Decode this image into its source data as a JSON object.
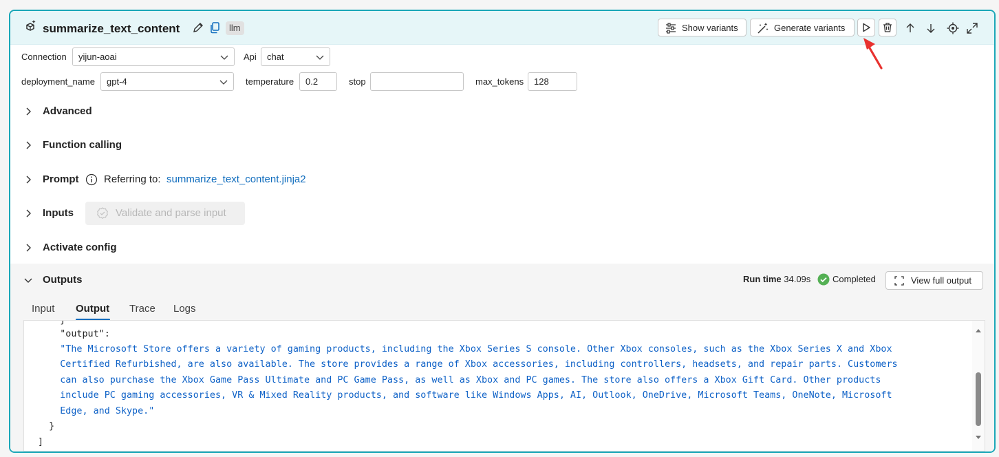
{
  "node": {
    "title": "summarize_text_content",
    "badge": "llm",
    "buttons": {
      "show_variants": "Show variants",
      "generate_variants": "Generate variants"
    }
  },
  "config": {
    "connection_label": "Connection",
    "connection_value": "yijun-aoai",
    "api_label": "Api",
    "api_value": "chat",
    "deployment_label": "deployment_name",
    "deployment_value": "gpt-4",
    "temperature_label": "temperature",
    "temperature_value": "0.2",
    "stop_label": "stop",
    "stop_value": "",
    "max_tokens_label": "max_tokens",
    "max_tokens_value": "128"
  },
  "sections": {
    "advanced": "Advanced",
    "function_calling": "Function calling",
    "prompt": "Prompt",
    "prompt_ref_label": "Referring to:",
    "prompt_ref_link": "summarize_text_content.jinja2",
    "inputs": "Inputs",
    "validate_button": "Validate and parse input",
    "activate_config": "Activate config",
    "outputs": "Outputs"
  },
  "outputs": {
    "run_time_label": "Run time",
    "run_time_value": "34.09s",
    "status": "Completed",
    "view_full_output": "View full output",
    "tabs": [
      "Input",
      "Output",
      "Trace",
      "Logs"
    ],
    "active_tab": "Output",
    "code_lines": [
      "    }",
      "    \"output\":",
      "    \"The Microsoft Store offers a variety of gaming products, including the Xbox Series S console. Other Xbox consoles, such as the Xbox Series X and Xbox",
      "    Certified Refurbished, are also available. The store provides a range of Xbox accessories, including controllers, headsets, and repair parts. Customers",
      "    can also purchase the Xbox Game Pass Ultimate and PC Game Pass, as well as Xbox and PC games. The store also offers a Xbox Gift Card. Other products",
      "    include PC gaming accessories, VR & Mixed Reality products, and software like Windows Apps, AI, Outlook, OneDrive, Microsoft Teams, OneNote, Microsoft",
      "    Edge, and Skype.\"",
      "  }",
      "]"
    ]
  },
  "colors": {
    "accent": "#1aa7b8",
    "link": "#0f6cbd",
    "string": "#0f62c7",
    "success": "#54b054",
    "annotation_arrow": "#e8322f"
  }
}
